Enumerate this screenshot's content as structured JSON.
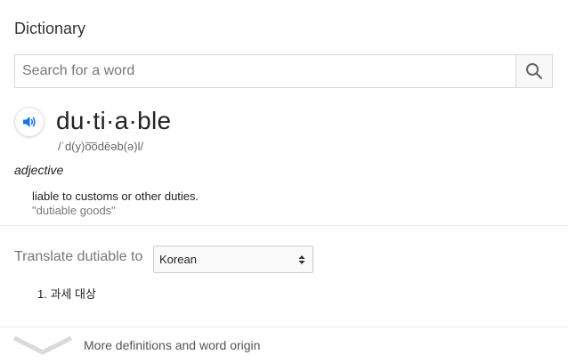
{
  "card": {
    "title": "Dictionary"
  },
  "search": {
    "placeholder": "Search for a word",
    "value": ""
  },
  "entry": {
    "headword": "du·ti·a·ble",
    "phonetic": "/ˈd(y)o͞odēəb(ə)l/",
    "part_of_speech": "adjective",
    "definition": "liable to customs or other duties.",
    "example": "\"dutiable goods\""
  },
  "translate": {
    "label": "Translate dutiable to",
    "language": "Korean",
    "results": [
      "1. 과세 대상"
    ]
  },
  "more": {
    "label": "More definitions and word origin"
  },
  "colors": {
    "accent": "#1a73e8",
    "text": "#222222",
    "muted": "#777777",
    "border": "#d9d9d9"
  },
  "icons": {
    "search": "magnifier-icon",
    "speaker": "speaker-icon",
    "select": "updown-arrows-icon",
    "expand": "chevron-down-icon"
  }
}
